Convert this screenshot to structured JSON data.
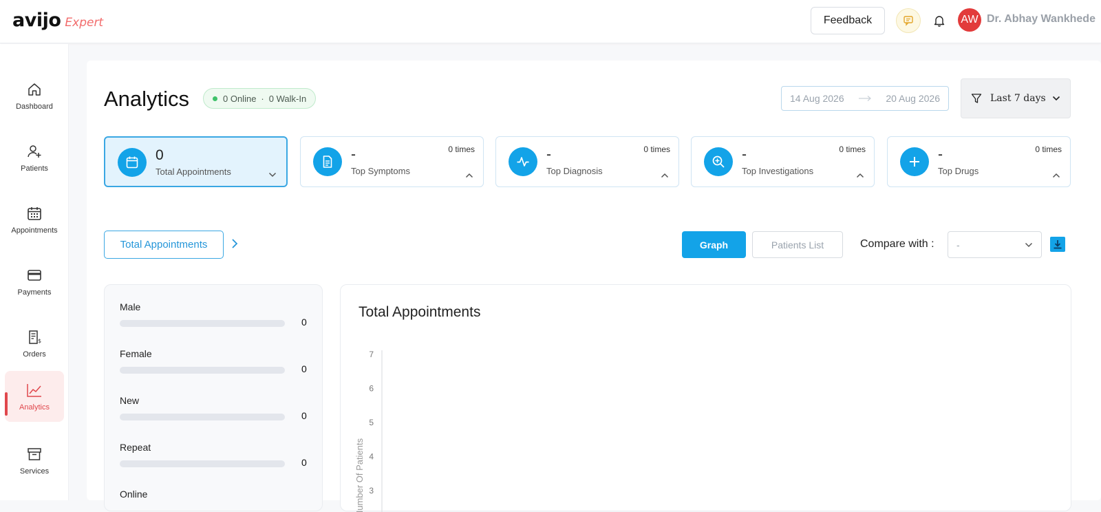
{
  "header": {
    "logo_main": "avijo",
    "logo_sub": "Expert",
    "feedback_label": "Feedback",
    "avatar_initials": "AW",
    "user_name": "Dr. Abhay Wankhede"
  },
  "sidebar": {
    "items": [
      {
        "label": "Dashboard",
        "icon": "home-icon"
      },
      {
        "label": "Patients",
        "icon": "user-plus-icon"
      },
      {
        "label": "Appointments",
        "icon": "calendar-icon"
      },
      {
        "label": "Payments",
        "icon": "card-icon"
      },
      {
        "label": "Orders",
        "icon": "receipt-icon"
      },
      {
        "label": "Analytics",
        "icon": "chart-line-icon"
      },
      {
        "label": "Services",
        "icon": "archive-icon"
      }
    ],
    "active": "Analytics"
  },
  "page": {
    "title": "Analytics",
    "status_online": "0 Online",
    "status_separator": "·",
    "status_walkin": "0 Walk-In",
    "date_from": "14 Aug 2026",
    "date_to": "20 Aug 2026",
    "period": "Last 7 days"
  },
  "cards": [
    {
      "value": "0",
      "label": "Total Appointments",
      "times": "",
      "icon": "calendar-icon",
      "expanded": false
    },
    {
      "value": "-",
      "label": "Top Symptoms",
      "times": "0 times",
      "icon": "document-icon",
      "expanded": true
    },
    {
      "value": "-",
      "label": "Top Diagnosis",
      "times": "0 times",
      "icon": "pulse-icon",
      "expanded": true
    },
    {
      "value": "-",
      "label": "Top Investigations",
      "times": "0 times",
      "icon": "search-plus-icon",
      "expanded": true
    },
    {
      "value": "-",
      "label": "Top Drugs",
      "times": "0 times",
      "icon": "plus-icon",
      "expanded": true
    }
  ],
  "controls": {
    "metric_label": "Total Appointments",
    "graph_label": "Graph",
    "list_label": "Patients List",
    "compare_label": "Compare with :",
    "compare_value": "-"
  },
  "breakdown": [
    {
      "label": "Male",
      "value": "0",
      "fraction": 0
    },
    {
      "label": "Female",
      "value": "0",
      "fraction": 0
    },
    {
      "label": "New",
      "value": "0",
      "fraction": 0
    },
    {
      "label": "Repeat",
      "value": "0",
      "fraction": 0
    },
    {
      "label": "Online",
      "value": "",
      "fraction": 0
    }
  ],
  "colors": {
    "accent": "#13a3e8",
    "brand_red": "#e0474c"
  },
  "chart_data": {
    "type": "line",
    "title": "Total Appointments",
    "ylabel": "Number Of Patients",
    "xlabel": "",
    "y_ticks": [
      "7",
      "6",
      "5",
      "4",
      "3"
    ],
    "ylim": [
      0,
      7
    ],
    "series": []
  }
}
